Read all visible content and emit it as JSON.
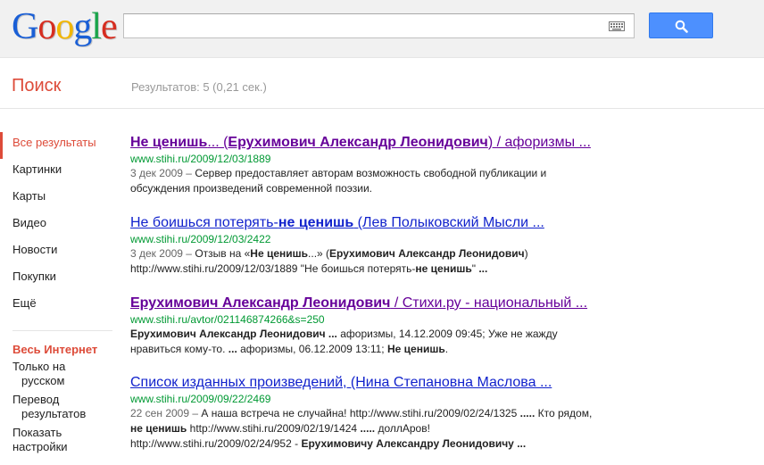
{
  "header": {
    "logo_letters": [
      "G",
      "o",
      "o",
      "g",
      "l",
      "e"
    ],
    "logo_colors": [
      "#1a5fd6",
      "#d62d20",
      "#f2b600",
      "#1a5fd6",
      "#19a44a",
      "#d62d20"
    ],
    "search_value": "",
    "search_placeholder": ""
  },
  "subheader": {
    "section_title": "Поиск",
    "result_stats": "Результатов: 5 (0,21 сек.)"
  },
  "nav": {
    "items": [
      {
        "label": "Все результаты",
        "active": true
      },
      {
        "label": "Картинки"
      },
      {
        "label": "Карты"
      },
      {
        "label": "Видео"
      },
      {
        "label": "Новости"
      },
      {
        "label": "Покупки"
      },
      {
        "label": "Ещё"
      }
    ],
    "scope_heading": "Весь Интернет",
    "scope_items": [
      {
        "line1": "Только на",
        "line2": "русском"
      },
      {
        "line1": "Перевод",
        "line2": "результатов"
      },
      {
        "line1": "Показать",
        "line2": "настройки"
      }
    ]
  },
  "results": [
    {
      "title_html": "<b>Не ценишь</b>... (<b>Ерухимович Александр Леонидович</b>) / афоризмы ...",
      "visited": true,
      "url": "www.stihi.ru/2009/12/03/1889",
      "snippet_html": "<span class=\"date\">3 дек 2009 – </span>Сервер предоставляет авторам возможность свободной публикации и обсуждения произведений современной поэзии."
    },
    {
      "title_html": "Не боишься потерять-<b>не ценишь</b> (Лев Полыковский Мысли ...",
      "visited": false,
      "url": "www.stihi.ru/2009/12/03/2422",
      "snippet_html": "<span class=\"date\">3 дек 2009 – </span>Отзыв на «<b>Не ценишь</b>...» (<b>Ерухимович Александр Леонидович</b>) http://www.stihi.ru/2009/12/03/1889 \"Не боишься потерять-<b>не ценишь</b>\" <b>...</b>"
    },
    {
      "title_html": "<b>Ерухимович Александр Леонидович</b> / Стихи.ру - национальный ...",
      "visited": true,
      "url": "www.stihi.ru/avtor/021146874266&s=250",
      "snippet_html": "<b>Ерухимович Александр Леонидович ...</b> афоризмы, 14.12.2009 09:45; Уже не жажду нравиться кому-то. <b>...</b> афоризмы, 06.12.2009 13:11; <b>Не ценишь</b>."
    },
    {
      "title_html": "Список изданных произведений, (Нина Степановна Маслова ...",
      "visited": false,
      "url": "www.stihi.ru/2009/09/22/2469",
      "snippet_html": "<span class=\"date\">22 сен 2009 – </span>А наша встреча не случайна! http://www.stihi.ru/2009/02/24/1325 <b>.....</b> Кто рядом, <b>не ценишь</b> http://www.stihi.ru/2009/02/19/1424 <b>.....</b> доллАров! http://www.stihi.ru/2009/02/24/952 - <b>Ерухимовичу Александру Леонидовичу ...</b>"
    }
  ]
}
